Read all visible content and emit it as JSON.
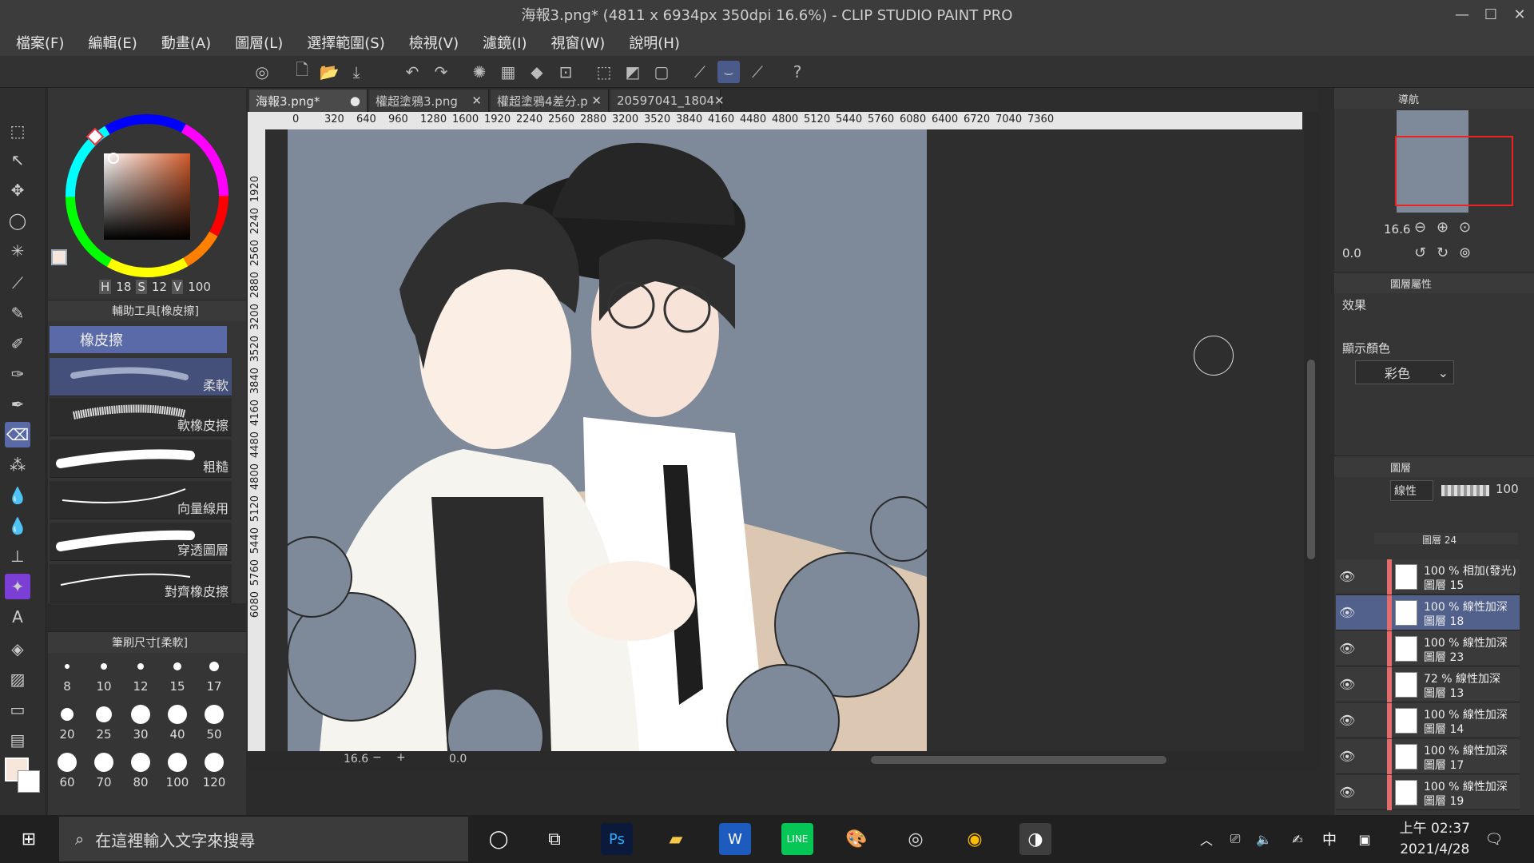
{
  "window": {
    "title": "海報3.png* (4811 x 6934px 350dpi 16.6%) - CLIP STUDIO PAINT PRO",
    "min": "—",
    "max": "☐",
    "close": "✕"
  },
  "menu": [
    "檔案(F)",
    "編輯(E)",
    "動畫(A)",
    "圖層(L)",
    "選擇範圍(S)",
    "檢視(V)",
    "濾鏡(I)",
    "視窗(W)",
    "說明(H)"
  ],
  "tabs": [
    {
      "label": "海報3.png*",
      "active": true
    },
    {
      "label": "權超塗鴉3.png",
      "active": false
    },
    {
      "label": "權超塗鴉4差分.p",
      "active": false
    },
    {
      "label": "20597041_1804",
      "active": false
    }
  ],
  "ruler_top": [
    "0",
    "320",
    "640",
    "960",
    "1280",
    "1600",
    "1920",
    "2240",
    "2560",
    "2880",
    "3200",
    "3520",
    "3840",
    "4160",
    "4480",
    "4800",
    "5120",
    "5440",
    "5760",
    "6080",
    "6400",
    "6720",
    "7040",
    "7360"
  ],
  "ruler_left": [
    "1920",
    "2240",
    "2560",
    "2880",
    "3200",
    "3520",
    "3840",
    "4160",
    "4480",
    "4800",
    "5120",
    "5440",
    "5760",
    "6080"
  ],
  "color": {
    "h_label": "H",
    "h": "18",
    "s_label": "S",
    "s": "12",
    "v_label": "V",
    "v": "100",
    "main": "#f6e6dc"
  },
  "subtool": {
    "header": "輔助工具[橡皮擦]",
    "group": "橡皮擦",
    "brushes": [
      "柔軟",
      "軟橡皮擦",
      "粗糙",
      "向量線用",
      "穿透圖層",
      "對齊橡皮擦"
    ]
  },
  "brushsize": {
    "header": "筆刷尺寸[柔軟]",
    "sizes": [
      "8",
      "10",
      "12",
      "15",
      "17",
      "20",
      "25",
      "30",
      "40",
      "50",
      "60",
      "70",
      "80",
      "100",
      "120"
    ]
  },
  "canvas_footer": {
    "zoom": "16.6",
    "angle": "0.0"
  },
  "navigator": {
    "tab": "導航",
    "zoom": "16.6",
    "angle": "0.0"
  },
  "property": {
    "tab": "圖層屬性",
    "effect": "效果",
    "display_color": "顯示顏色",
    "color_mode": "彩色"
  },
  "layers": {
    "tab": "圖層",
    "blend": "線性",
    "opacity": "100",
    "items": [
      {
        "t1": "100 % 相加(發光)",
        "t2": "圖層 15",
        "sel": false
      },
      {
        "t1": "100 % 線性加深",
        "t2": "圖層 18",
        "sel": true
      },
      {
        "t1": "100 % 線性加深",
        "t2": "圖層 23",
        "sel": false
      },
      {
        "t1": "72 % 線性加深",
        "t2": "圖層 13",
        "sel": false
      },
      {
        "t1": "100 % 線性加深",
        "t2": "圖層 14",
        "sel": false
      },
      {
        "t1": "100 % 線性加深",
        "t2": "圖層 17",
        "sel": false
      },
      {
        "t1": "100 % 線性加深",
        "t2": "圖層 19",
        "sel": false
      }
    ],
    "partial_top": "圖層 24"
  },
  "taskbar": {
    "search_placeholder": "在這裡輸入文字來搜尋",
    "time": "上午 02:37",
    "date": "2021/4/28",
    "ime": "中"
  },
  "colors": {
    "accent": "#5a6aa8",
    "selected_layer": "#51618c",
    "canvas_bg": "#7e8a99"
  }
}
